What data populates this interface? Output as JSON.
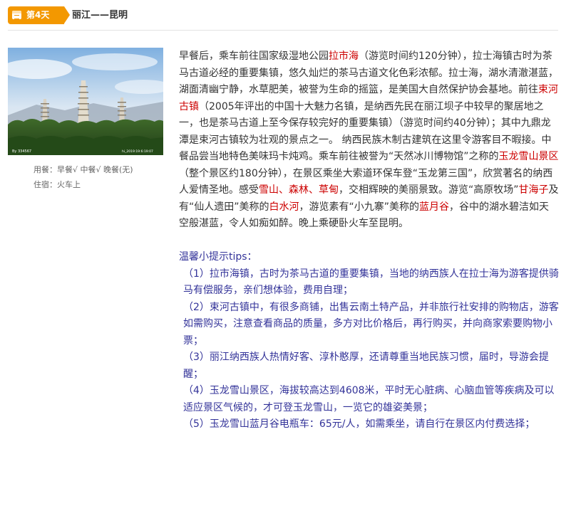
{
  "header": {
    "day_label": "第4天",
    "route": "丽江——昆明"
  },
  "photo": {
    "icon": "landscape-photo-pagodas",
    "watermark_left": "By 334567",
    "watermark_right": "hi_2019:19:6:19:07"
  },
  "meta": {
    "meals_label": "用餐：",
    "meals_value": "早餐√ 中餐√ 晚餐(无)",
    "lodging_label": "住宿：",
    "lodging_value": "火车上"
  },
  "itinerary": {
    "segments": [
      {
        "text": "早餐后，乘车前往国家级湿地公园",
        "highlight": false
      },
      {
        "text": "拉市海",
        "highlight": true
      },
      {
        "text": "（游览时间约120分钟），拉士海镇古时为茶马古道必经的重要集镇，悠久灿烂的茶马古道文化色彩浓郁。拉士海，湖水清澈湛蓝，湖面清幽宁静，水草肥美，被誉为生命的摇篮，是美国大自然保护协会基地。前往",
        "highlight": false
      },
      {
        "text": "束河古镇",
        "highlight": true
      },
      {
        "text": "（2005年评出的中国十大魅力名镇，是纳西先民在丽江坝子中较早的聚居地之一，也是茶马古道上至今保存较完好的重要集镇）（游览时间约40分钟）；其中九鼎龙潭是束河古镇较为壮观的景点之一。 纳西民族木制古建筑在这里令游客目不暇接。中餐品尝当地特色美味玛卡炖鸡。乘车前往被誉为“天然冰川博物馆”之称的",
        "highlight": false
      },
      {
        "text": "玉龙雪山景区",
        "highlight": true
      },
      {
        "text": "（整个景区约180分钟），在景区乘坐大索道环保车登“玉龙第三国”，欣赏著名的纳西人爱情圣地。感受",
        "highlight": false
      },
      {
        "text": "雪山、森林、草甸",
        "highlight": true
      },
      {
        "text": "，交相辉映的美丽景致。游览“高原牧场”",
        "highlight": false
      },
      {
        "text": "甘海子",
        "highlight": true
      },
      {
        "text": "及有“仙人遗田”美称的",
        "highlight": false
      },
      {
        "text": "白水河",
        "highlight": true
      },
      {
        "text": "，游览素有“小九寨”美称的",
        "highlight": false
      },
      {
        "text": "蓝月谷",
        "highlight": true
      },
      {
        "text": "，谷中的湖水碧洁如天空般湛蓝，令人如痴如醉。晚上乘硬卧火车至昆明。",
        "highlight": false
      }
    ]
  },
  "tips": {
    "title": "温馨小提示tips：",
    "items": [
      "（1）拉市海镇，古时为茶马古道的重要集镇，当地的纳西族人在拉士海为游客提供骑马有偿服务，亲们想体验，费用自理；",
      "（2）束河古镇中，有很多商铺，出售云南土特产品，并非旅行社安排的购物店，游客如需购买，注意查看商品的质量，多方对比价格后，再行购买，并向商家索要购物小票；",
      "（3）丽江纳西族人热情好客、淳朴憨厚，还请尊重当地民族习惯，届时，导游会提醒；",
      "（4）玉龙雪山景区，海拔较高达到4608米，平时无心脏病、心脑血管等疾病及可以适应景区气候的，才可登玉龙雪山，一览它的雄姿美景；",
      "（5）玉龙雪山蓝月谷电瓶车：65元/人，如需乘坐，请自行在景区内付费选择；"
    ]
  },
  "colors": {
    "badge": "#f39800",
    "highlight": "#cc0000",
    "tips_text": "#333399",
    "body_text": "#333333"
  }
}
